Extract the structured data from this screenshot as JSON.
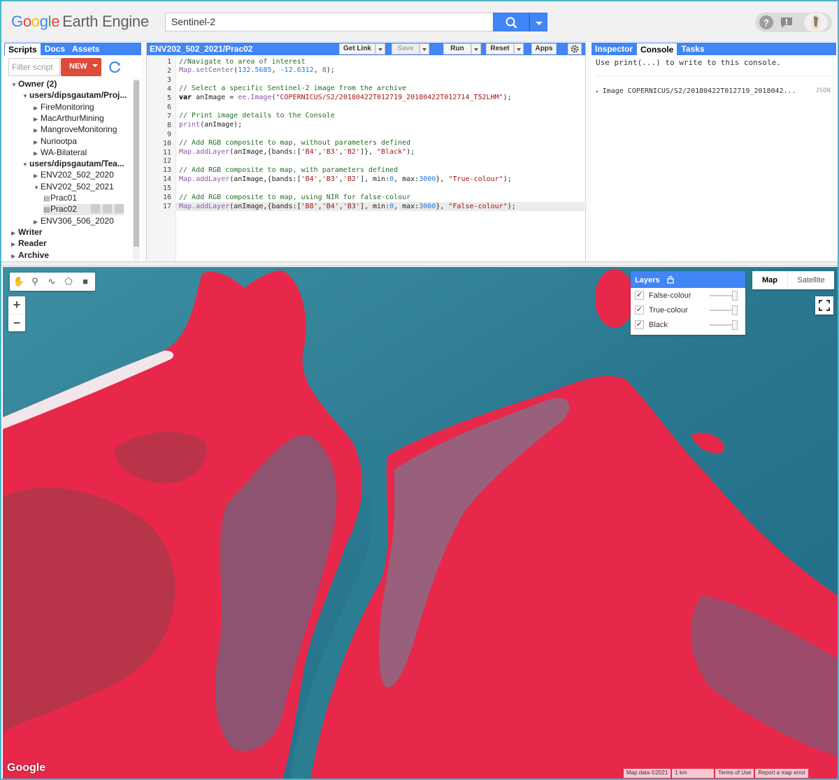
{
  "header": {
    "logo": {
      "g1": "G",
      "g2": "o",
      "g3": "o",
      "g4": "g",
      "g5": "l",
      "g6": "e",
      "suffix": "Earth Engine"
    },
    "search_value": "Sentinel-2",
    "icons": [
      "search-icon",
      "chevron-down-icon",
      "help-icon",
      "feedback-icon",
      "avatar"
    ]
  },
  "left_panel": {
    "tabs": [
      "Scripts",
      "Docs",
      "Assets"
    ],
    "filter_placeholder": "Filter script",
    "new_label": "NEW",
    "tree": [
      {
        "label": "Owner  (2)",
        "bold": true,
        "caret": "down"
      },
      {
        "label": "users/dipsgautam/Proj...",
        "bold": true,
        "caret": "down"
      },
      {
        "label": "FireMonitoring",
        "caret": "right"
      },
      {
        "label": "MacArthurMining",
        "caret": "right"
      },
      {
        "label": "MangroveMonitoring",
        "caret": "right"
      },
      {
        "label": "Nuriootpa",
        "caret": "right"
      },
      {
        "label": "WA-Bilateral",
        "caret": "right"
      },
      {
        "label": "users/dipsgautam/Tea...",
        "bold": true,
        "caret": "down"
      },
      {
        "label": "ENV202_502_2020",
        "caret": "right"
      },
      {
        "label": "ENV202_502_2021",
        "caret": "down"
      },
      {
        "label": "Prac01",
        "caret": "file"
      },
      {
        "label": "Prac02",
        "caret": "file"
      },
      {
        "label": "ENV306_506_2020",
        "caret": "right"
      },
      {
        "label": "Writer",
        "bold": true,
        "caret": "right"
      },
      {
        "label": "Reader",
        "bold": true,
        "caret": "right"
      },
      {
        "label": "Archive",
        "bold": true,
        "caret": "right"
      }
    ]
  },
  "editor": {
    "title": "ENV202_502_2021/Prac02",
    "buttons": {
      "get_link": "Get Link",
      "save": "Save",
      "run": "Run",
      "reset": "Reset",
      "apps": "Apps"
    },
    "lines": [
      [
        [
          "cm",
          "//Navigate to area of interest"
        ]
      ],
      [
        [
          "fn",
          "Map.setCenter"
        ],
        [
          "pl",
          "("
        ],
        [
          "num",
          "132.5685"
        ],
        [
          "pl",
          ", "
        ],
        [
          "num",
          "-12.6312"
        ],
        [
          "pl",
          ", "
        ],
        [
          "num",
          "8"
        ],
        [
          "pl",
          ");"
        ]
      ],
      [],
      [
        [
          "cm",
          "// Select a specific Sentinel-2 image from the archive"
        ]
      ],
      [
        [
          "kw",
          "var"
        ],
        [
          "pl",
          " anImage = "
        ],
        [
          "fn",
          "ee.Image"
        ],
        [
          "pl",
          "("
        ],
        [
          "str",
          "\"COPERNICUS/S2/20180422T012719_20180422T012714_T52LHM\""
        ],
        [
          "pl",
          ");"
        ]
      ],
      [],
      [
        [
          "cm",
          "// Print image details to the Console"
        ]
      ],
      [
        [
          "fn",
          "print"
        ],
        [
          "pl",
          "(anImage);"
        ]
      ],
      [],
      [
        [
          "cm",
          "// Add RGB composite to map, without parameters defined"
        ]
      ],
      [
        [
          "fn",
          "Map.addLayer"
        ],
        [
          "pl",
          "(anImage,{bands:["
        ],
        [
          "str",
          "'B4'"
        ],
        [
          "pl",
          ","
        ],
        [
          "str",
          "'B3'"
        ],
        [
          "pl",
          ","
        ],
        [
          "str",
          "'B2'"
        ],
        [
          "pl",
          "]}, "
        ],
        [
          "str",
          "\"Black\""
        ],
        [
          "pl",
          ");"
        ]
      ],
      [],
      [
        [
          "cm",
          "// Add RGB composite to map, with parameters defined"
        ]
      ],
      [
        [
          "fn",
          "Map.addLayer"
        ],
        [
          "pl",
          "(anImage,{bands:["
        ],
        [
          "str",
          "'B4'"
        ],
        [
          "pl",
          ","
        ],
        [
          "str",
          "'B3'"
        ],
        [
          "pl",
          ","
        ],
        [
          "str",
          "'B2'"
        ],
        [
          "pl",
          "], min:"
        ],
        [
          "num",
          "0"
        ],
        [
          "pl",
          ", max:"
        ],
        [
          "num",
          "3000"
        ],
        [
          "pl",
          "}, "
        ],
        [
          "str",
          "\"True-colour\""
        ],
        [
          "pl",
          ");"
        ]
      ],
      [],
      [
        [
          "cm",
          "// Add RGB composite to map, using NIR for false-colour"
        ]
      ],
      [
        [
          "fn",
          "Map.addLayer"
        ],
        [
          "pl",
          "(anImage,{bands:["
        ],
        [
          "str",
          "'B8'"
        ],
        [
          "pl",
          ","
        ],
        [
          "str",
          "'B4'"
        ],
        [
          "pl",
          ","
        ],
        [
          "str",
          "'B3'"
        ],
        [
          "pl",
          "], min:"
        ],
        [
          "num",
          "0"
        ],
        [
          "pl",
          ", max:"
        ],
        [
          "num",
          "3000"
        ],
        [
          "pl",
          "}, "
        ],
        [
          "str",
          "\"False-colour\""
        ],
        [
          "pl",
          ");"
        ]
      ]
    ]
  },
  "right_panel": {
    "tabs": [
      "Inspector",
      "Console",
      "Tasks"
    ],
    "hint": "Use print(...) to write to this console.",
    "entry": "Image COPERNICUS/S2/20180422T012719_2018042...",
    "entry_type": "JSON"
  },
  "map": {
    "layers_title": "Layers",
    "layers": [
      {
        "name": "False-colour",
        "checked": true
      },
      {
        "name": "True-colour",
        "checked": true
      },
      {
        "name": "Black",
        "checked": true
      }
    ],
    "map_type": {
      "map": "Map",
      "satellite": "Satellite"
    },
    "zoom_in": "+",
    "zoom_out": "−",
    "watermark": "Google",
    "attribution": [
      "Map data ©2021",
      "1 km",
      "Terms of Use",
      "Report a map error"
    ],
    "colors": {
      "water": "#2f7f94",
      "vegetation": "#e8284a",
      "mudflat": "#7c5a78"
    }
  }
}
